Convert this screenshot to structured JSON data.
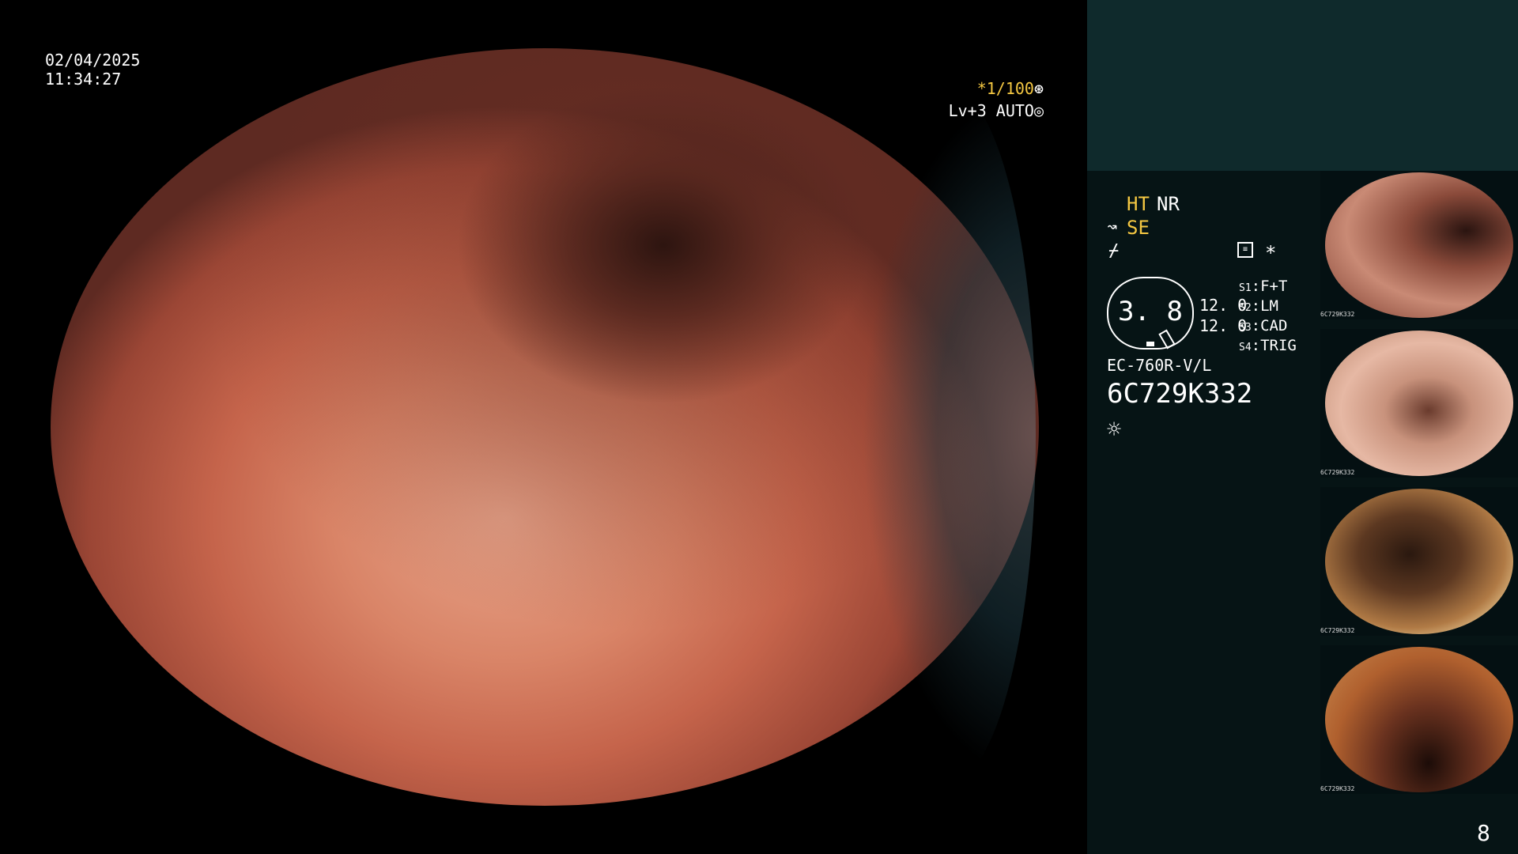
{
  "header": {
    "date": "02/04/2025",
    "time": "11:34:27"
  },
  "overlay": {
    "shutter": "*1/100",
    "shutter_icon": "⊛",
    "level": "Lv+3 AUTO",
    "level_icon": "◎"
  },
  "panel": {
    "ht": "HT",
    "nr": "NR",
    "se_icon": "↝",
    "se": "SE",
    "wave_icon": "⌿",
    "menu_icon": "≡",
    "star_icon": "*",
    "gauge_value": "3. 8",
    "readout_1": "12. 0",
    "readout_2": "12. 0",
    "slots": [
      {
        "key": "S1",
        "value": "F+T"
      },
      {
        "key": "S2",
        "value": "LM"
      },
      {
        "key": "S3",
        "value": "CAD"
      },
      {
        "key": "S4",
        "value": "TRIG"
      }
    ],
    "model": "EC-760R-V/L",
    "serial": "6C729K332",
    "sun_icon": "☼"
  },
  "thumbnails": [
    {
      "label": "6C729K332"
    },
    {
      "label": "6C729K332"
    },
    {
      "label": "6C729K332"
    },
    {
      "label": "6C729K332"
    }
  ],
  "page_number": "8"
}
